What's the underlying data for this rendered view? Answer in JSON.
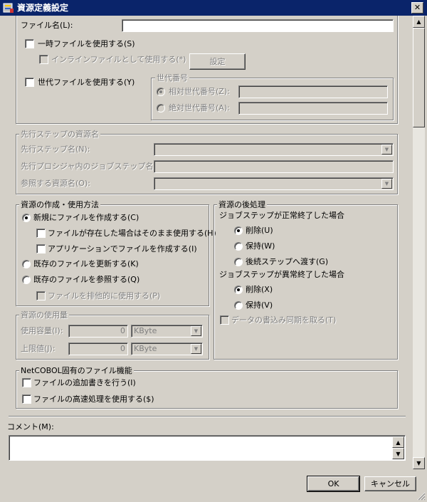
{
  "window": {
    "title": "資源定義設定",
    "close_glyph": "✕"
  },
  "file": {
    "label": "ファイル名(L):",
    "value": "",
    "temp_label": "一時ファイルを使用する(S)",
    "inline_label": "インラインファイルとして使用する(*)",
    "settings_button": "設定",
    "generation_label": "世代ファイルを使用する(Y)",
    "generation_group": "世代番号",
    "relative_label": "相対世代番号(Z):",
    "absolute_label": "絶対世代番号(A):"
  },
  "prior_step": {
    "group": "先行ステップの資源名",
    "step_name_label": "先行ステップ名(N):",
    "proc_step_label": "先行プロシジャ内のジョブステップ名(B):",
    "ref_resource_label": "参照する資源名(O):"
  },
  "create_use": {
    "group": "資源の作成・使用方法",
    "new_label": "新規にファイルを作成する(C)",
    "exists_label": "ファイルが存在した場合はそのまま使用する(H)",
    "app_create_label": "アプリケーションでファイルを作成する(I)",
    "update_label": "既存のファイルを更新する(K)",
    "ref_label": "既存のファイルを参照する(Q)",
    "exclusive_label": "ファイルを排他的に使用する(P)"
  },
  "post": {
    "group": "資源の後処理",
    "normal_label": "ジョブステップが正常終了した場合",
    "normal_delete": "削除(U)",
    "normal_keep": "保持(W)",
    "normal_pass": "後続ステップへ渡す(G)",
    "abnormal_label": "ジョブステップが異常終了した場合",
    "abnormal_delete": "削除(X)",
    "abnormal_keep": "保持(V)",
    "sync_label": "データの書込み同期を取る(T)"
  },
  "usage": {
    "group": "資源の使用量",
    "capacity_label": "使用容量(I):",
    "capacity_value": "0",
    "capacity_unit": "KByte",
    "limit_label": "上限値(J):",
    "limit_value": "0",
    "limit_unit": "KByte"
  },
  "netcobol": {
    "group": "NetCOBOL固有のファイル機能",
    "append_label": "ファイルの追加書きを行う(I)",
    "fast_label": "ファイルの高速処理を使用する($)"
  },
  "comment": {
    "label": "コメント(M):",
    "value": ""
  },
  "buttons": {
    "ok": "OK",
    "cancel": "キャンセル"
  },
  "icons": {
    "scroll_up": "▲",
    "scroll_down": "▼",
    "combo": "▼"
  },
  "colors": {
    "titlebar": "#0a246a",
    "face": "#d4d0c8",
    "disabled_text": "#808080"
  }
}
